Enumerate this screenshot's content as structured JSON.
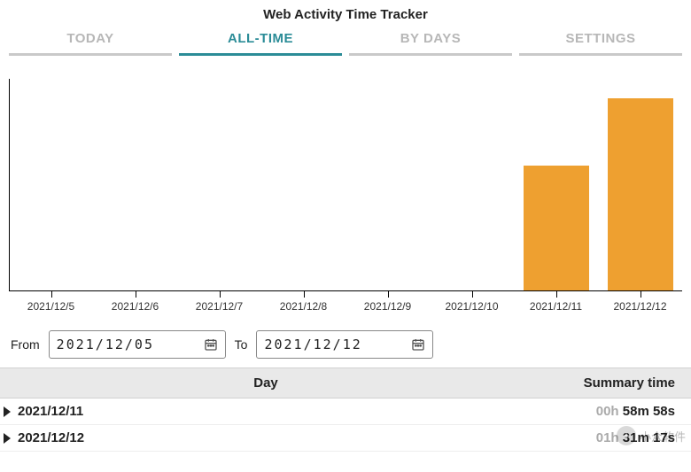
{
  "title": "Web Activity Time Tracker",
  "tabs": [
    {
      "label": "TODAY",
      "active": false
    },
    {
      "label": "ALL-TIME",
      "active": true
    },
    {
      "label": "BY DAYS",
      "active": false
    },
    {
      "label": "SETTINGS",
      "active": false
    }
  ],
  "chart_data": {
    "type": "bar",
    "categories": [
      "2021/12/5",
      "2021/12/6",
      "2021/12/7",
      "2021/12/8",
      "2021/12/9",
      "2021/12/10",
      "2021/12/11",
      "2021/12/12"
    ],
    "values": [
      0,
      0,
      0,
      0,
      0,
      0,
      59,
      91
    ],
    "title": "",
    "xlabel": "",
    "ylabel": "",
    "ylim": [
      0,
      100
    ],
    "bar_color": "#eea030"
  },
  "range": {
    "from_label": "From",
    "from_value": "2021/12/05",
    "to_label": "To",
    "to_value": "2021/12/12"
  },
  "table": {
    "columns": {
      "day": "Day",
      "summary": "Summary time"
    },
    "rows": [
      {
        "day": "2021/12/11",
        "summary_hour": "00h",
        "summary_rest": " 58m 58s"
      },
      {
        "day": "2021/12/12",
        "summary_hour": "01h",
        "summary_rest": " 31m 17s"
      }
    ]
  },
  "watermark": "小众软件"
}
